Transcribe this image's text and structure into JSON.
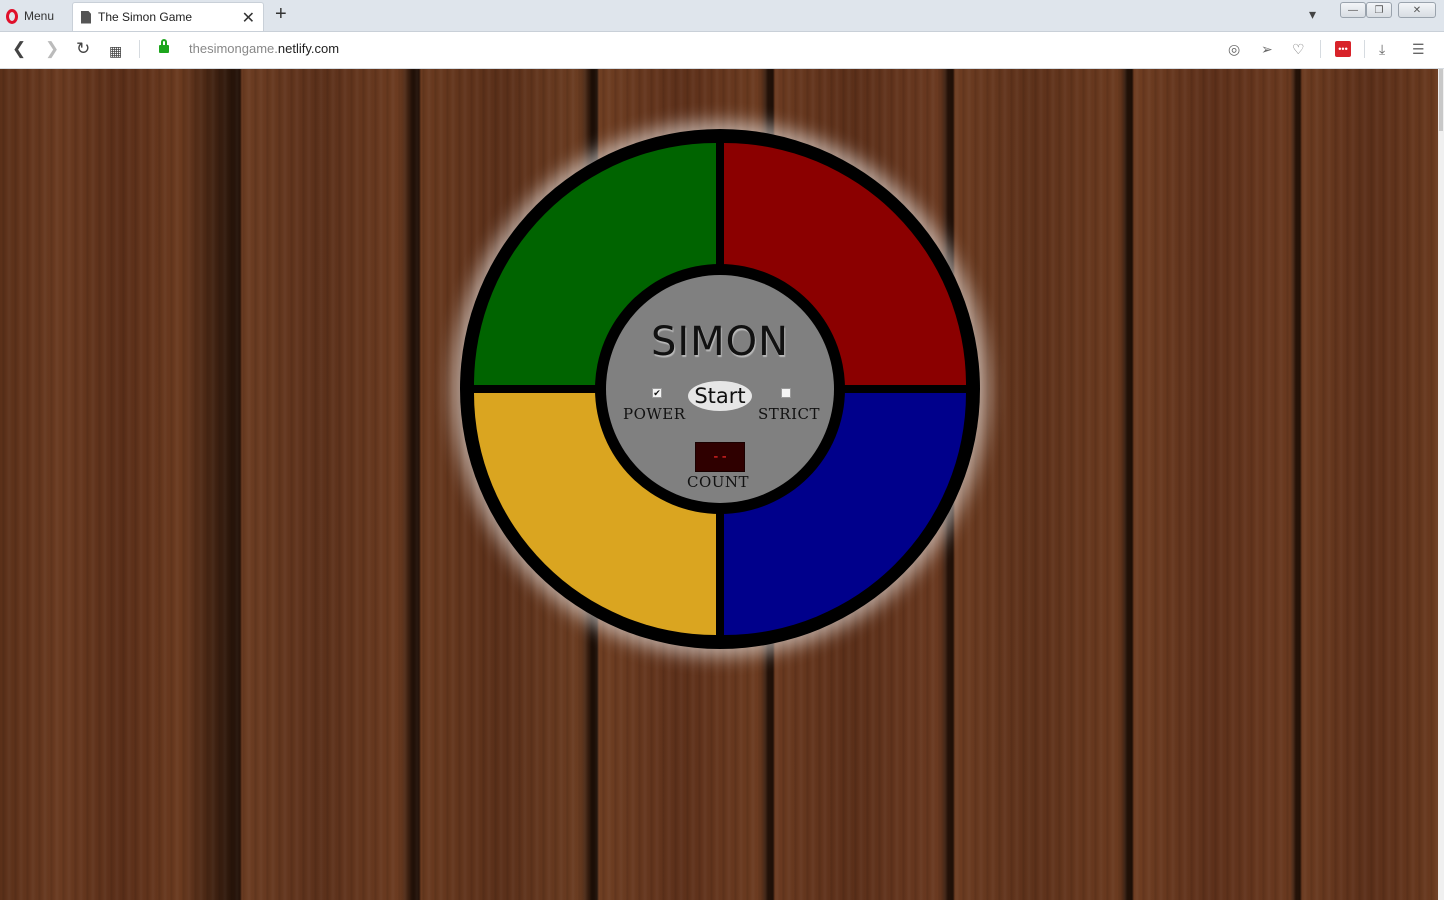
{
  "browser": {
    "menu_label": "Menu",
    "tab_title": "The Simon Game",
    "url_host_dim": "thesimongame.",
    "url_host": "netlify.com"
  },
  "game": {
    "title": "SIMON",
    "start_label": "Start",
    "power_label": "POWER",
    "strict_label": "STRICT",
    "count_label": "COUNT",
    "count_value": "--",
    "power_on": true,
    "strict_on": false,
    "quadrants": [
      {
        "name": "green",
        "color": "#006400"
      },
      {
        "name": "red",
        "color": "#8b0000"
      },
      {
        "name": "yellow",
        "color": "#daa520"
      },
      {
        "name": "blue",
        "color": "#00008b"
      }
    ]
  }
}
